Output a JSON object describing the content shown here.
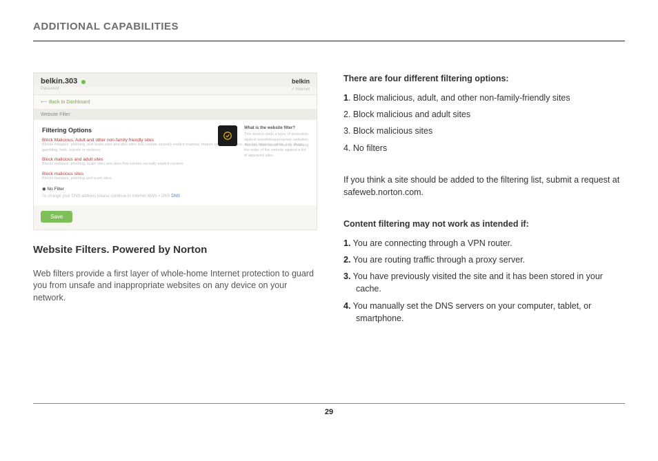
{
  "header": {
    "title": "ADDITIONAL CAPABILITIES"
  },
  "screenshot": {
    "router_name": "belkin.303",
    "sub_left": "Password",
    "brand": "belkin",
    "sub_right": "✓ internet",
    "back_link": "⟵ Back to Dashboard",
    "crumb": "Website Filter",
    "panel_title": "Filtering Options",
    "options": [
      {
        "label": "Block Malicious, Adult and other non-family friendly sites",
        "desc": "Blocks malware, phishing, and scam sites and also sites that contain sexually explicit material, mature content, abortion, alcohol, tobacco, crime, cult, drugs, gambling, hate, suicide or violence."
      },
      {
        "label": "Block malicious and adult sites",
        "desc": "Blocks malware, phishing, scam sites and sites that contain sexually explicit content."
      },
      {
        "label": "Block malicious sites",
        "desc": "Blocks malware, phishing and scam sites."
      },
      {
        "label_black": "No Filter",
        "desc": "To change your DNS address please continue to Internet WAN > DNS"
      }
    ],
    "help_title": "What is the website filter?",
    "help_body": "This service adds a layer of protection against unsafe/inappropriate websites. You can filter certain sites by choosing the order of the website against a list of approved sites.",
    "save": "Save"
  },
  "left": {
    "heading": "Website Filters. Powered by Norton",
    "para": "Web filters provide a first layer of whole-home Internet protection to guard you from unsafe and inappropriate websites on any device on your network."
  },
  "right": {
    "h1": "There are four different filtering options:",
    "opt1_num": "1",
    "opt1": ". Block malicious, adult, and other non-family-friendly sites",
    "opt2": "2. Block malicious and adult sites",
    "opt3": "3. Block malicious sites",
    "opt4": "4. No filters",
    "note": "If you think a site should be added to the filtering list, submit a request at safeweb.norton.com.",
    "h2": "Content filtering may not work as intended if:",
    "c1b": "1.",
    "c1": " You are connecting through a VPN router.",
    "c2b": "2.",
    "c2": " You are routing traffic through a proxy server.",
    "c3b": "3.",
    "c3": " You have previously visited the site and it has been stored in your cache.",
    "c4b": "4.",
    "c4": " You manually set the DNS servers on your computer, tablet, or smartphone."
  },
  "page_number": "29"
}
